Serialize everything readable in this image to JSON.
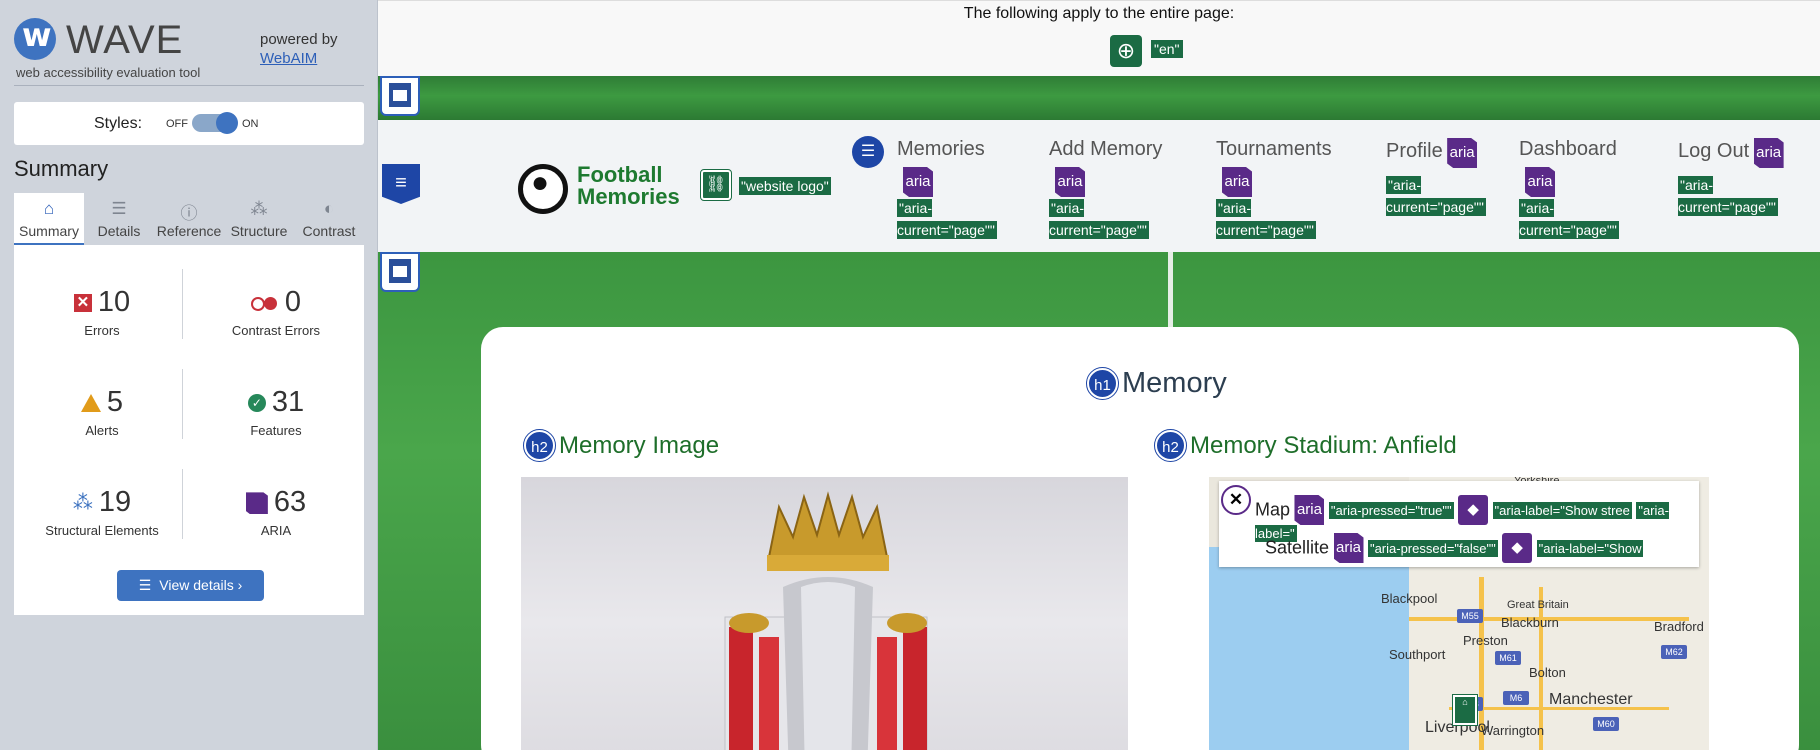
{
  "wave": {
    "logo_word": "WAVE",
    "tagline": "web accessibility evaluation tool",
    "powered_by": "powered by",
    "webaim_link": "WebAIM",
    "styles_label": "Styles:",
    "toggle_off": "OFF",
    "toggle_on": "ON",
    "summary_title": "Summary",
    "tabs": [
      {
        "label": "Summary",
        "icon": "home-icon"
      },
      {
        "label": "Details",
        "icon": "list-icon"
      },
      {
        "label": "Reference",
        "icon": "info-icon"
      },
      {
        "label": "Structure",
        "icon": "structure-icon"
      },
      {
        "label": "Contrast",
        "icon": "contrast-icon"
      }
    ],
    "stats": {
      "errors": {
        "count": "10",
        "label": "Errors"
      },
      "contrast": {
        "count": "0",
        "label": "Contrast Errors"
      },
      "alerts": {
        "count": "5",
        "label": "Alerts"
      },
      "features": {
        "count": "31",
        "label": "Features"
      },
      "structure": {
        "count": "19",
        "label": "Structural Elements"
      },
      "aria": {
        "count": "63",
        "label": "ARIA"
      }
    },
    "view_details": "View details ›"
  },
  "page": {
    "notice": "The following apply to the entire page:",
    "lang": "\"en\"",
    "brand_line1": "Football",
    "brand_line2": "Memories",
    "logo_alt": "\"website logo\"",
    "nav": [
      {
        "label": "Memories",
        "aria": "\"aria-current=\"page\"\""
      },
      {
        "label": "Add Memory",
        "aria": "\"aria-current=\"page\"\""
      },
      {
        "label": "Tournaments",
        "aria": "\"aria-current=\"page\"\""
      },
      {
        "label": "Profile",
        "aria": "\"aria-current=\"page\"\""
      },
      {
        "label": "Dashboard",
        "aria": "\"aria-current=\"page\"\""
      },
      {
        "label": "Log Out",
        "aria": "\"aria-current=\"page\"\""
      }
    ],
    "aria_badge": "aria",
    "h1_badge": "h1",
    "h2_badge": "h2",
    "h1": "Memory",
    "h2_image": "Memory Image",
    "h2_stadium": "Memory Stadium: Anfield",
    "map": {
      "map_label": "Map",
      "satellite_label": "Satellite",
      "map_pressed": "\"aria-pressed=\"true\"\"",
      "sat_pressed": "\"aria-pressed=\"false\"\"",
      "map_arialabel": "\"aria-label=\"Show stree",
      "sat_arialabel": "\"aria-label=\"Show",
      "right_clip": "\"aria-label=\"",
      "places": {
        "blackpool": "Blackpool",
        "blackburn": "Blackburn",
        "preston": "Preston",
        "southport": "Southport",
        "bolton": "Bolton",
        "manchester": "Manchester",
        "liverpool": "Liverpool",
        "warrington": "Warrington",
        "great_britain": "Great Britain",
        "bradford": "Bradford",
        "yorkshire": "Yorkshire"
      },
      "roads": {
        "m55": "M55",
        "m61": "M61",
        "m6": "M6",
        "m60": "M60",
        "m62": "M62",
        "m58": "M58"
      }
    }
  }
}
